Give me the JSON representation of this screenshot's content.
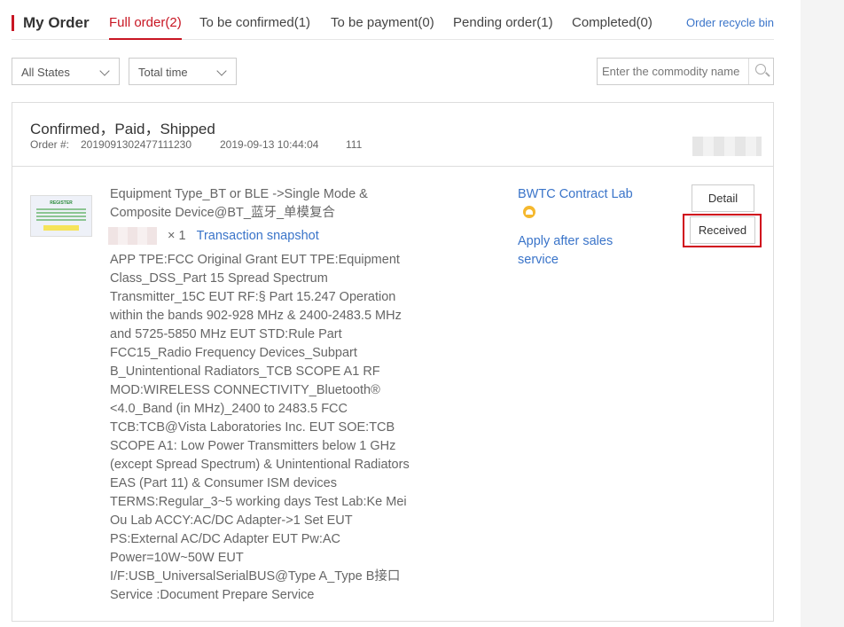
{
  "header": {
    "title": "My Order",
    "tabs": [
      {
        "label": "Full order(2)",
        "active": true
      },
      {
        "label": "To be confirmed(1)",
        "active": false
      },
      {
        "label": "To be payment(0)",
        "active": false
      },
      {
        "label": "Pending order(1)",
        "active": false
      },
      {
        "label": "Completed(0)",
        "active": false
      }
    ],
    "recycle_label": "Order recycle bin"
  },
  "filters": {
    "state_select": "All States",
    "time_select": "Total time",
    "search_placeholder": "Enter the commodity name"
  },
  "order": {
    "status": "Confirmed，Paid，Shipped",
    "order_no_label": "Order #:",
    "order_no": "2019091302477111230",
    "datetime": "2019-09-13 10:44:04",
    "extra": "111",
    "product": {
      "thumbnail_text": "REGISTER",
      "name": "Equipment Type_BT or BLE ->Single Mode & Composite Device@BT_蓝牙_单模复合",
      "quantity": "× 1",
      "snapshot_label": "Transaction snapshot",
      "description": "APP TPE:FCC Original Grant EUT TPE:Equipment Class_DSS_Part 15 Spread Spectrum Transmitter_15C EUT RF:§ Part 15.247 Operation within the bands 902-928 MHz & 2400-2483.5 MHz and 5725-5850 MHz EUT STD:Rule Part FCC15_Radio Frequency Devices_Subpart B_Unintentional Radiators_TCB SCOPE A1 RF MOD:WIRELESS CONNECTIVITY_Bluetooth® <4.0_Band (in MHz)_2400 to 2483.5 FCC TCB:TCB@Vista Laboratories Inc. EUT SOE:TCB SCOPE A1: Low Power Transmitters below 1 GHz (except Spread Spectrum) & Unintentional Radiators EAS (Part 11) & Consumer ISM devices TERMS:Regular_3~5 working days Test Lab:Ke Mei Ou Lab ACCY:AC/DC Adapter->1 Set EUT PS:External AC/DC Adapter EUT Pw:AC Power=10W~50W EUT I/F:USB_UniversalSerialBUS@Type A_Type B接口 Service :Document Prepare Service"
    },
    "seller": "BWTC Contract Lab",
    "after_sale": "Apply after sales service",
    "buttons": {
      "detail": "Detail",
      "received": "Received"
    }
  },
  "colors": {
    "accent": "#c81623",
    "link": "#3a74c9",
    "highlight": "#d0021b"
  }
}
